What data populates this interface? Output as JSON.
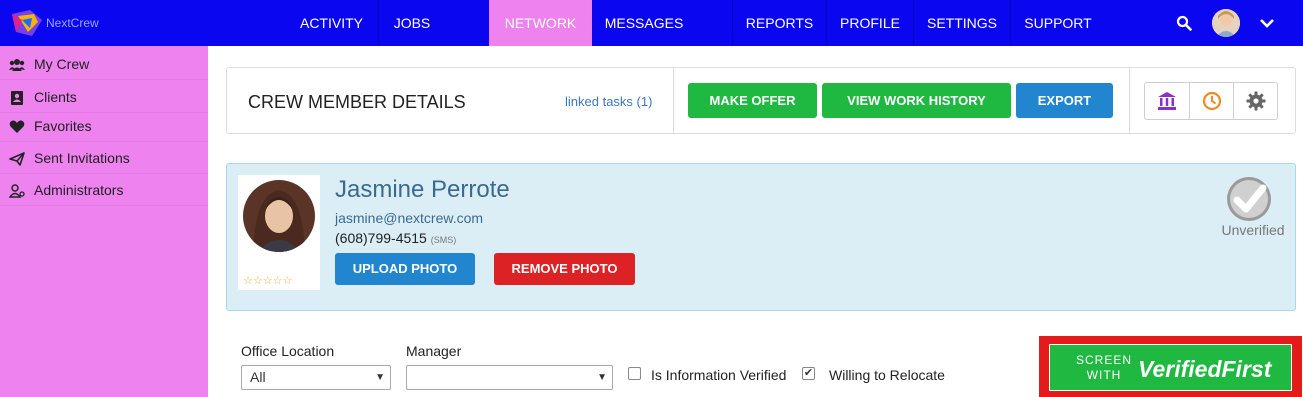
{
  "brand": {
    "name": "NextCrew"
  },
  "nav": {
    "items": [
      {
        "label": "ACTIVITY"
      },
      {
        "label": "JOBS"
      },
      {
        "label": "NETWORK",
        "active": true
      },
      {
        "label": "MESSAGES"
      },
      {
        "label": "REPORTS"
      },
      {
        "label": "PROFILE"
      },
      {
        "label": "SETTINGS"
      },
      {
        "label": "SUPPORT"
      }
    ],
    "icons": [
      "search-icon",
      "user-avatar",
      "chevron-down-icon"
    ]
  },
  "sidebar": {
    "items": [
      {
        "label": "My Crew",
        "icon": "users-icon"
      },
      {
        "label": "Clients",
        "icon": "contact-card-icon"
      },
      {
        "label": "Favorites",
        "icon": "heart-icon"
      },
      {
        "label": "Sent Invitations",
        "icon": "paper-plane-icon"
      },
      {
        "label": "Administrators",
        "icon": "user-admin-icon"
      }
    ]
  },
  "header": {
    "title": "CREW MEMBER DETAILS",
    "linked_tasks": "linked tasks (1)",
    "make_offer": "MAKE OFFER",
    "view_work_history": "VIEW WORK HISTORY",
    "export": "EXPORT",
    "icon_buttons": [
      "bank-icon",
      "clock-icon",
      "gear-icon"
    ]
  },
  "profile": {
    "name": "Jasmine Perrote",
    "email": "jasmine@nextcrew.com",
    "phone": "(608)799-4515",
    "phone_tag": "(SMS)",
    "stars": "☆☆☆☆☆",
    "rating": 0,
    "upload_photo": "UPLOAD PHOTO",
    "remove_photo": "REMOVE PHOTO",
    "verification_status": "Unverified"
  },
  "form": {
    "office_location_label": "Office Location",
    "office_location_value": "All",
    "manager_label": "Manager",
    "manager_value": "",
    "info_verified_label": "Is Information Verified",
    "info_verified_checked": false,
    "relocate_label": "Willing to Relocate",
    "relocate_checked": true
  },
  "verified_first": {
    "screen_with": "SCREEN WITH",
    "brand": "VerifiedFirst"
  },
  "colors": {
    "nav_bg": "#0a07f0",
    "accent_pink": "#ee82ee",
    "green": "#1fb941",
    "blue": "#2185d0",
    "red": "#dd2225",
    "highlight_red": "#e31b1b",
    "profile_bg": "#dbeef6"
  }
}
